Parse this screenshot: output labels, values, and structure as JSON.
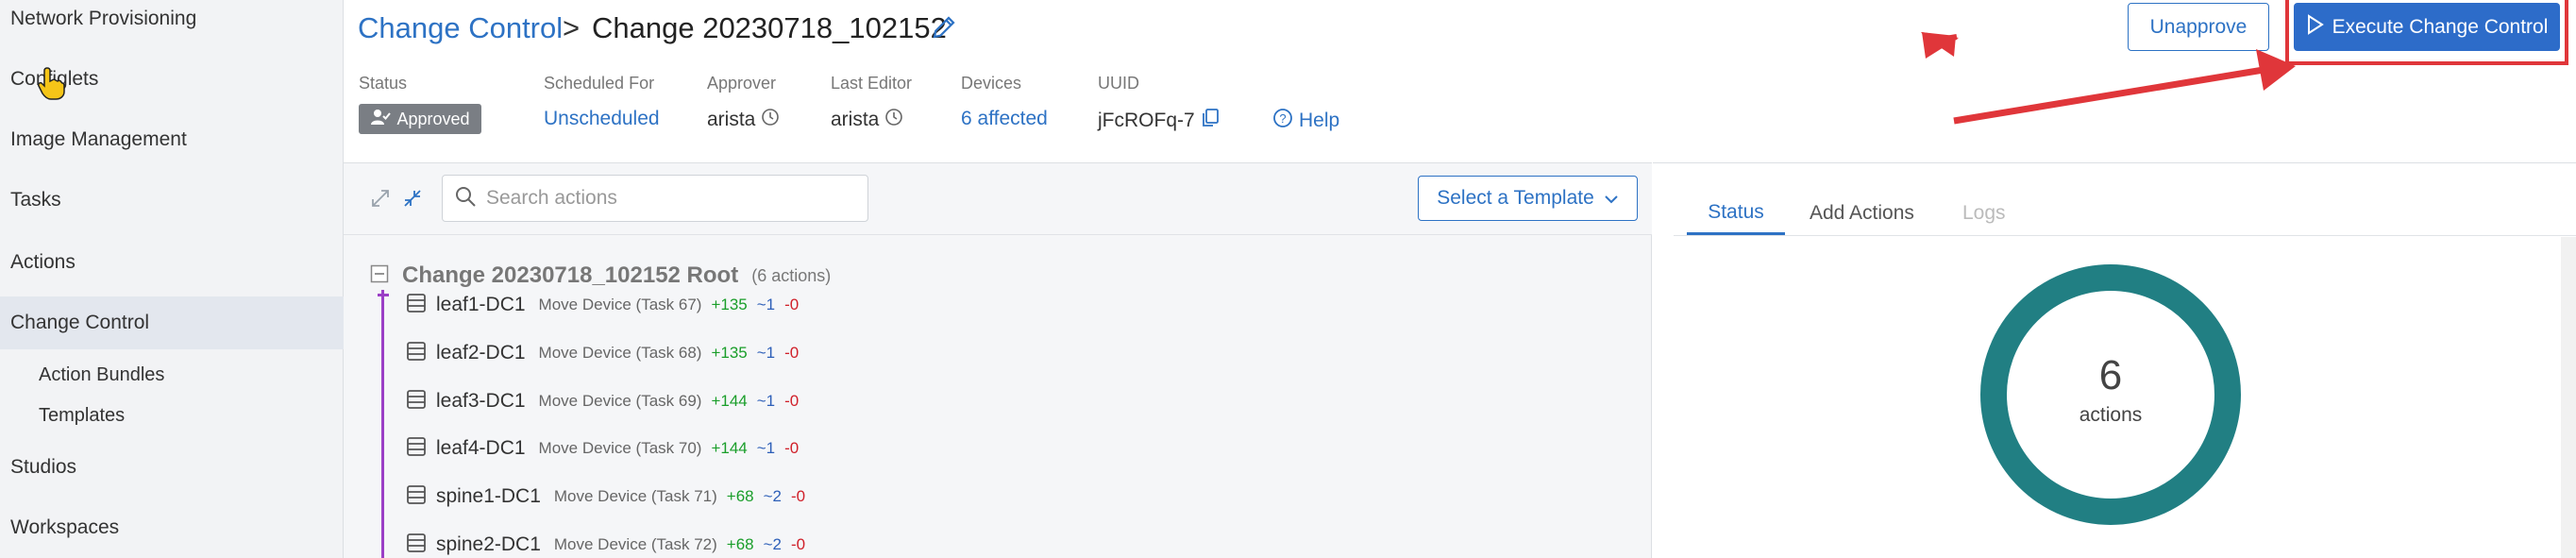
{
  "sidebar": {
    "items": [
      {
        "label": "Network Provisioning"
      },
      {
        "label": "Configlets"
      },
      {
        "label": "Image Management"
      },
      {
        "label": "Tasks"
      },
      {
        "label": "Actions"
      },
      {
        "label": "Change Control"
      },
      {
        "label": "Action Bundles"
      },
      {
        "label": "Templates"
      },
      {
        "label": "Studios"
      },
      {
        "label": "Workspaces"
      }
    ]
  },
  "header": {
    "breadcrumb_link": "Change Control",
    "breadcrumb_sep": ">",
    "title": "Change 20230718_102152",
    "unapprove_label": "Unapprove",
    "execute_label": "Execute Change Control"
  },
  "meta": {
    "status_label": "Status",
    "status_value": "Approved",
    "scheduled_label": "Scheduled For",
    "scheduled_value": "Unscheduled",
    "approver_label": "Approver",
    "approver_value": "arista",
    "editor_label": "Last Editor",
    "editor_value": "arista",
    "devices_label": "Devices",
    "devices_value": "6 affected",
    "uuid_label": "UUID",
    "uuid_value": "jFcROFq-7",
    "help_label": "Help"
  },
  "actions_panel": {
    "search_placeholder": "Search actions",
    "template_label": "Select a Template",
    "root_title": "Change 20230718_102152 Root",
    "root_count": "(6 actions)",
    "rows": [
      {
        "name": "leaf1-DC1",
        "task": "Move Device (Task 67)",
        "add": "+135",
        "mod": "~1",
        "del": "-0"
      },
      {
        "name": "leaf2-DC1",
        "task": "Move Device (Task 68)",
        "add": "+135",
        "mod": "~1",
        "del": "-0"
      },
      {
        "name": "leaf3-DC1",
        "task": "Move Device (Task 69)",
        "add": "+144",
        "mod": "~1",
        "del": "-0"
      },
      {
        "name": "leaf4-DC1",
        "task": "Move Device (Task 70)",
        "add": "+144",
        "mod": "~1",
        "del": "-0"
      },
      {
        "name": "spine1-DC1",
        "task": "Move Device (Task 71)",
        "add": "+68",
        "mod": "~2",
        "del": "-0"
      },
      {
        "name": "spine2-DC1",
        "task": "Move Device (Task 72)",
        "add": "+68",
        "mod": "~2",
        "del": "-0"
      }
    ]
  },
  "right_panel": {
    "tabs": [
      {
        "label": "Status"
      },
      {
        "label": "Add Actions"
      },
      {
        "label": "Logs"
      }
    ],
    "donut_count": "6",
    "donut_label": "actions"
  },
  "colors": {
    "accent": "#2d72c4",
    "execute_bg": "#2d6cc9",
    "annotation": "#e0363a",
    "donut": "#217f83",
    "tree_line": "#9b3fc6",
    "add": "#1a9e2a",
    "modify": "#2d5fb8",
    "delete": "#d0202a"
  }
}
